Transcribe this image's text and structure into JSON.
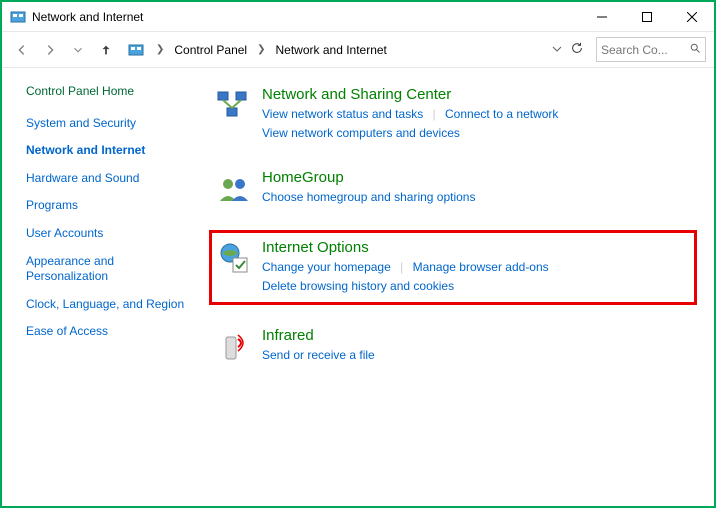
{
  "window": {
    "title": "Network and Internet"
  },
  "breadcrumb": {
    "item1": "Control Panel",
    "item2": "Network and Internet"
  },
  "search": {
    "placeholder": "Search Co..."
  },
  "sidebar": {
    "home": "Control Panel Home",
    "items": [
      "System and Security",
      "Network and Internet",
      "Hardware and Sound",
      "Programs",
      "User Accounts",
      "Appearance and Personalization",
      "Clock, Language, and Region",
      "Ease of Access"
    ]
  },
  "categories": {
    "nsc": {
      "title": "Network and Sharing Center",
      "t1": "View network status and tasks",
      "t2": "Connect to a network",
      "t3": "View network computers and devices"
    },
    "hg": {
      "title": "HomeGroup",
      "t1": "Choose homegroup and sharing options"
    },
    "io": {
      "title": "Internet Options",
      "t1": "Change your homepage",
      "t2": "Manage browser add-ons",
      "t3": "Delete browsing history and cookies"
    },
    "ir": {
      "title": "Infrared",
      "t1": "Send or receive a file"
    }
  }
}
